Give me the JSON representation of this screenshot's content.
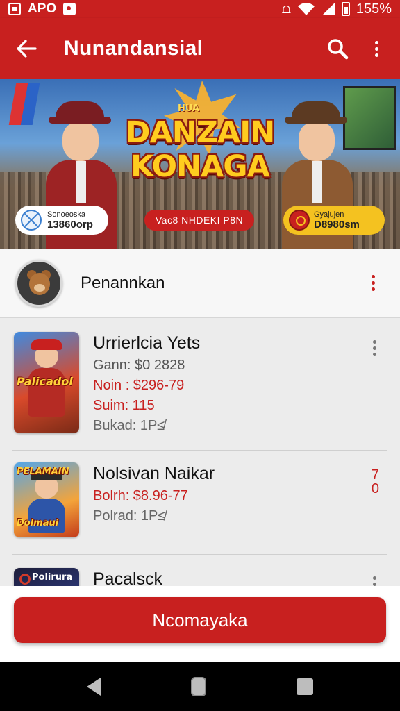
{
  "status_bar": {
    "carrier": "APO",
    "battery_percent": "155%"
  },
  "app_bar": {
    "title": "Nunandansial"
  },
  "banner": {
    "small_title": "HUA",
    "title_line1": "DANZAIN",
    "title_line2": "KONAGA",
    "left_pill": {
      "line1": "Sonoeoska",
      "line2": "13860orp"
    },
    "center_pill": "Vac8 NHDEKI P8N",
    "right_pill": {
      "line1": "Gyajujen",
      "line2": "D8980sm"
    }
  },
  "profile": {
    "name": "Penannkan"
  },
  "list": {
    "items": [
      {
        "title": "Urrierlcia Yets",
        "lines": [
          "Gann: $0 2828",
          "Noin : $296-79",
          "Suim: 115",
          "Bukad: 1P≰"
        ],
        "thumb_label": "Palicadol",
        "badge": ""
      },
      {
        "title": "Nolsivan Naikar",
        "lines": [
          "Bolrh: $8.96-77",
          "Polrad: 1P≰"
        ],
        "thumb_label_top": "PELAMAIN",
        "thumb_label_bottom": "Dolmaui",
        "badge": "7\n0"
      },
      {
        "title": "Pacalsck",
        "lines": [],
        "thumb_label": "Polirura",
        "badge": ""
      }
    ]
  },
  "bottom": {
    "button_label": "Ncomayaka"
  },
  "colors": {
    "brand_red": "#c8201f",
    "accent_yellow": "#f4c220"
  }
}
